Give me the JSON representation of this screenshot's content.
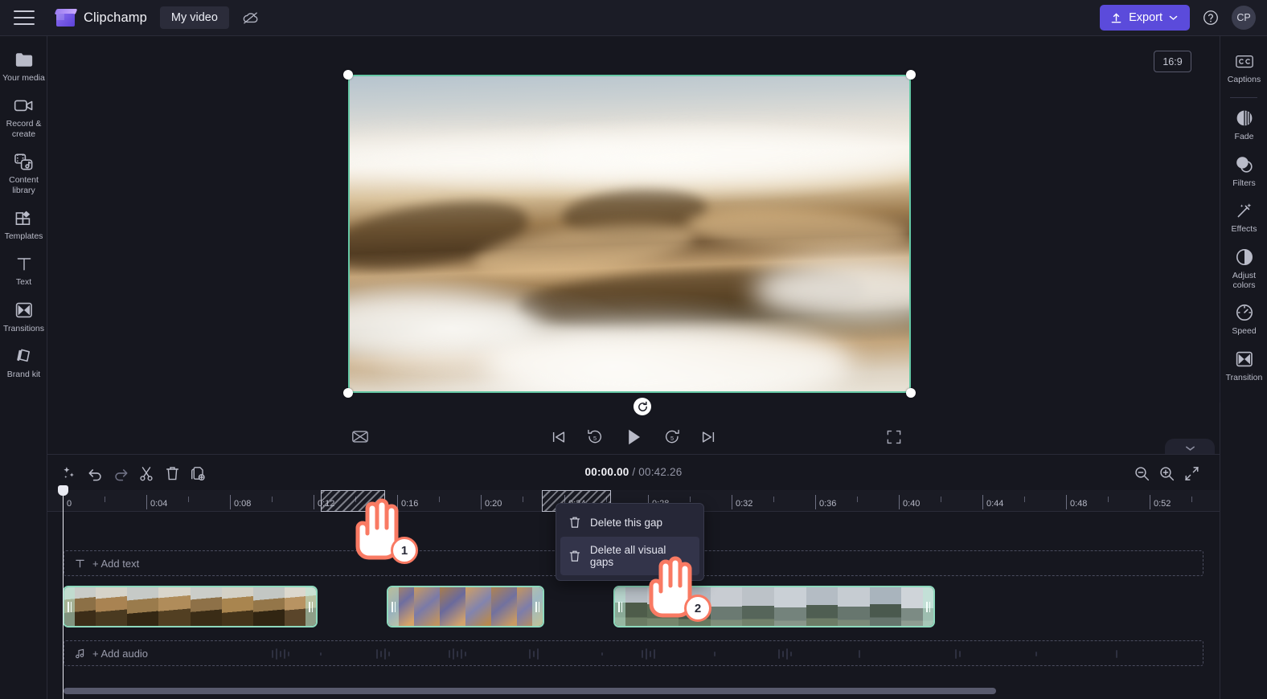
{
  "header": {
    "menu_icon": "hamburger-icon",
    "brand_name": "Clipchamp",
    "doc_title": "My video",
    "cloud_icon": "cloud-off-icon",
    "export_label": "Export",
    "export_icon": "upload-icon",
    "export_caret": "chevron-down-icon",
    "help_icon": "help-circle-icon",
    "avatar_initials": "CP",
    "accent_color": "#5b4bdb"
  },
  "left_rail": {
    "items": [
      {
        "label": "Your media",
        "icon": "folder-icon"
      },
      {
        "label": "Record & create",
        "icon": "video-camera-icon"
      },
      {
        "label": "Content library",
        "icon": "content-library-icon"
      },
      {
        "label": "Templates",
        "icon": "templates-grid-icon"
      },
      {
        "label": "Text",
        "icon": "text-t-icon"
      },
      {
        "label": "Transitions",
        "icon": "transitions-icon"
      },
      {
        "label": "Brand kit",
        "icon": "brand-kit-icon"
      }
    ],
    "collapse_icon": "chevron-right-icon"
  },
  "right_rail": {
    "items": [
      {
        "label": "Captions",
        "icon": "closed-captions-icon"
      },
      {
        "label": "Fade",
        "icon": "fade-circle-icon"
      },
      {
        "label": "Filters",
        "icon": "filters-overlap-icon"
      },
      {
        "label": "Effects",
        "icon": "effects-wand-icon"
      },
      {
        "label": "Adjust colors",
        "icon": "contrast-half-circle-icon"
      },
      {
        "label": "Speed",
        "icon": "speedometer-icon"
      },
      {
        "label": "Transition",
        "icon": "transition-icon"
      }
    ],
    "collapse_icon": "chevron-left-icon"
  },
  "preview": {
    "aspect_ratio": "16:9",
    "selection_color": "#66c9a6",
    "rotate_icon": "rotate-icon",
    "collapse_down_icon": "chevron-down-icon"
  },
  "player": {
    "captions_toggle_icon": "captions-off-icon",
    "skip_start_icon": "skip-to-start-icon",
    "rewind_label": "5",
    "rewind_icon": "rewind-5-icon",
    "play_icon": "play-icon",
    "forward_label": "5",
    "forward_icon": "forward-5-icon",
    "skip_end_icon": "skip-to-end-icon",
    "fullscreen_icon": "fullscreen-icon"
  },
  "timeline": {
    "tools": [
      {
        "name": "magic-ai-icon"
      },
      {
        "name": "undo-icon"
      },
      {
        "name": "redo-icon"
      },
      {
        "name": "split-scissors-icon"
      },
      {
        "name": "delete-trash-icon"
      },
      {
        "name": "duplicate-icon"
      }
    ],
    "current_time": "00:00.00",
    "separator": "/",
    "total_time": "00:42.26",
    "zoom_out_icon": "zoom-out-icon",
    "zoom_in_icon": "zoom-in-icon",
    "fit_icon": "fit-to-timeline-icon",
    "ruler_labels": [
      "0",
      "0:04",
      "0:08",
      "0:12",
      "0:16",
      "0:20",
      "0:24",
      "0:28",
      "0:32",
      "0:36",
      "0:40",
      "0:44",
      "0:48",
      "0:52"
    ],
    "text_track_label": "+ Add text",
    "text_track_icon": "text-t-icon",
    "audio_track_label": "+ Add audio",
    "audio_track_icon": "music-note-icon",
    "clip_border_color": "#8ed9bd",
    "gaps": [
      {
        "start_label": "0:12",
        "end_label": "0:15"
      },
      {
        "start_label": "0:24",
        "end_label": "0:27"
      }
    ],
    "clips": [
      {
        "name": "desert-dunes-clip"
      },
      {
        "name": "canyon-clip"
      },
      {
        "name": "mountains-clip"
      }
    ]
  },
  "context_menu": {
    "items": [
      {
        "label": "Delete this gap",
        "icon": "trash-icon",
        "highlighted": false
      },
      {
        "label": "Delete all visual gaps",
        "icon": "trash-icon",
        "highlighted": true
      }
    ]
  },
  "annotations": {
    "cursors": [
      {
        "badge": "1",
        "target": "gap-region-first"
      },
      {
        "badge": "2",
        "target": "delete-all-visual-gaps"
      }
    ],
    "accent_color": "#f97a63"
  }
}
